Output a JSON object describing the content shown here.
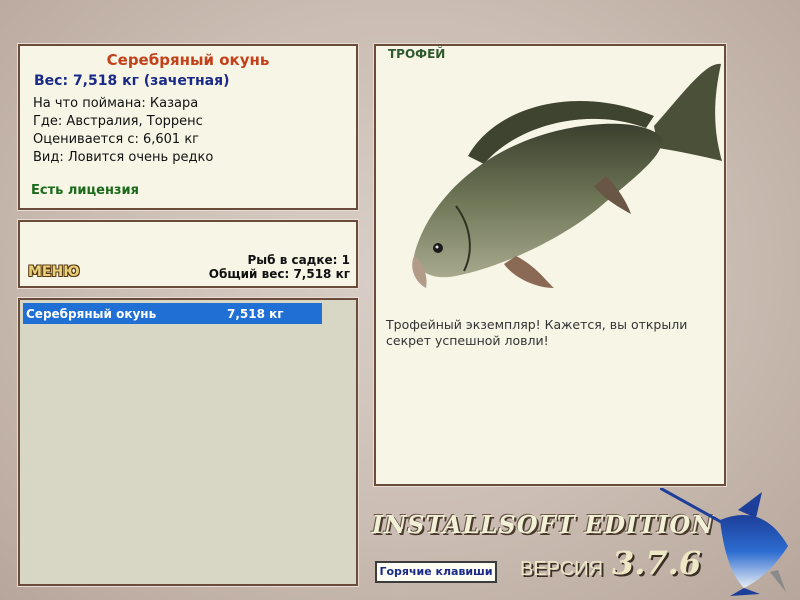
{
  "fish_card": {
    "name": "Серебряный окунь",
    "weight_line": "Вес: 7,518 кг (зачетная)",
    "bait": "На что поймана: Казара",
    "location": "Где: Австралия, Торренс",
    "rated_from": "Оценивается с: 6,601 кг",
    "rarity": "Вид: Ловится очень редко",
    "license": "Есть лицензия"
  },
  "summary": {
    "menu_label": "МЕНЮ",
    "fish_count": "Рыб в садке: 1",
    "total_weight": "Общий вес: 7,518 кг"
  },
  "catch_list": [
    {
      "name": "Серебряный окунь",
      "weight": "7,518 кг",
      "selected": true
    }
  ],
  "trophy_panel": {
    "label": "ТРОФЕЙ",
    "message": "Трофейный экземпляр! Кажется, вы открыли секрет успешной ловли!",
    "image": "silver-perch-fish-illustration"
  },
  "footer": {
    "edition": "INSTALLSOFT EDITION",
    "hotkeys_label": "Горячие клавиши",
    "version_label": "ВЕРСИЯ",
    "version_number": "3.7.6",
    "logo": "marlin-logo"
  }
}
